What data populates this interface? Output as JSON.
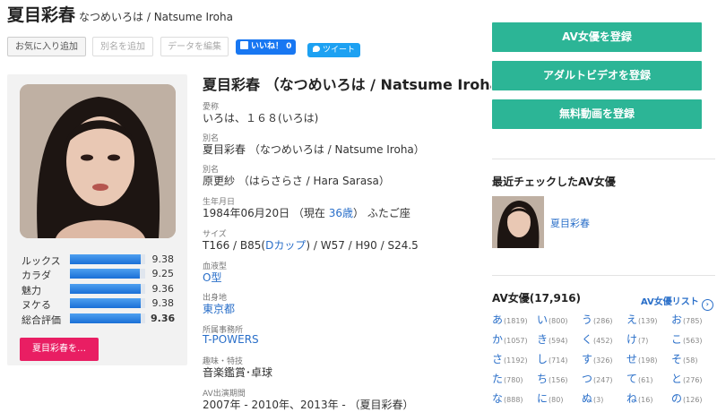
{
  "header": {
    "title": "夏目彩春",
    "subtitle": "なつめいろは / Natsume Iroha"
  },
  "toolbar": {
    "favorite": "お気に入り追加",
    "add_alias": "別名を追加",
    "edit_data": "データを編集",
    "like_label": "いいね！",
    "like_count": "0",
    "tweet": "ツイート"
  },
  "profile": {
    "name_button": "夏目彩春を…",
    "stats": [
      {
        "label": "ルックス",
        "value": "9.38",
        "score": 9.38
      },
      {
        "label": "カラダ",
        "value": "9.25",
        "score": 9.25
      },
      {
        "label": "魅力",
        "value": "9.36",
        "score": 9.36
      },
      {
        "label": "ヌケる",
        "value": "9.38",
        "score": 9.38
      },
      {
        "label": "総合評価",
        "value": "9.36",
        "score": 9.36
      }
    ]
  },
  "info": {
    "name": "夏目彩春 （なつめいろは / Natsume Iroha）",
    "fields": {
      "nickname_label": "愛称",
      "nickname": "いろは、１６８(いろは)",
      "alias1_label": "別名",
      "alias1": "夏目彩春 （なつめいろは / Natsume Iroha）",
      "alias2_label": "別名",
      "alias2": "原更紗 （はらさらさ / Hara Sarasa）",
      "birth_label": "生年月日",
      "birth_pre": "1984年06月20日 （現在 ",
      "birth_age": "36歳",
      "birth_post": "） ふたご座",
      "size_label": "サイズ",
      "size_pre": "T166 / B85(",
      "size_cup": "Dカップ",
      "size_post": ") / W57 / H90 / S24.5",
      "blood_label": "血液型",
      "blood": "O型",
      "birthplace_label": "出身地",
      "birthplace": "東京都",
      "agency_label": "所属事務所",
      "agency": "T-POWERS",
      "hobby_label": "趣味・特技",
      "hobby": "音楽鑑賞･卓球",
      "period_label": "AV出演期間",
      "period": "2007年 - 2010年、2013年 - （夏目彩春）"
    }
  },
  "sidebar": {
    "buttons": [
      "AV女優を登録",
      "アダルトビデオを登録",
      "無料動画を登録"
    ],
    "recent_title": "最近チェックしたAV女優",
    "recent_name": "夏目彩春",
    "index_title": "AV女優(17,916)",
    "index_list": "AV女優リスト",
    "index_arrow": "›",
    "kana": [
      {
        "k": "あ",
        "c": "(1819)"
      },
      {
        "k": "い",
        "c": "(800)"
      },
      {
        "k": "う",
        "c": "(286)"
      },
      {
        "k": "え",
        "c": "(139)"
      },
      {
        "k": "お",
        "c": "(785)"
      },
      {
        "k": "か",
        "c": "(1057)"
      },
      {
        "k": "き",
        "c": "(594)"
      },
      {
        "k": "く",
        "c": "(452)"
      },
      {
        "k": "け",
        "c": "(7)"
      },
      {
        "k": "こ",
        "c": "(563)"
      },
      {
        "k": "さ",
        "c": "(1192)"
      },
      {
        "k": "し",
        "c": "(714)"
      },
      {
        "k": "す",
        "c": "(326)"
      },
      {
        "k": "せ",
        "c": "(198)"
      },
      {
        "k": "そ",
        "c": "(58)"
      },
      {
        "k": "た",
        "c": "(780)"
      },
      {
        "k": "ち",
        "c": "(156)"
      },
      {
        "k": "つ",
        "c": "(247)"
      },
      {
        "k": "て",
        "c": "(61)"
      },
      {
        "k": "と",
        "c": "(276)"
      },
      {
        "k": "な",
        "c": "(888)"
      },
      {
        "k": "に",
        "c": "(80)"
      },
      {
        "k": "ぬ",
        "c": "(3)"
      },
      {
        "k": "ね",
        "c": "(16)"
      },
      {
        "k": "の",
        "c": "(126)"
      }
    ]
  },
  "colors": {
    "accent_green": "#2cb596",
    "accent_pink": "#e91e63",
    "link_blue": "#2a6fc9"
  }
}
